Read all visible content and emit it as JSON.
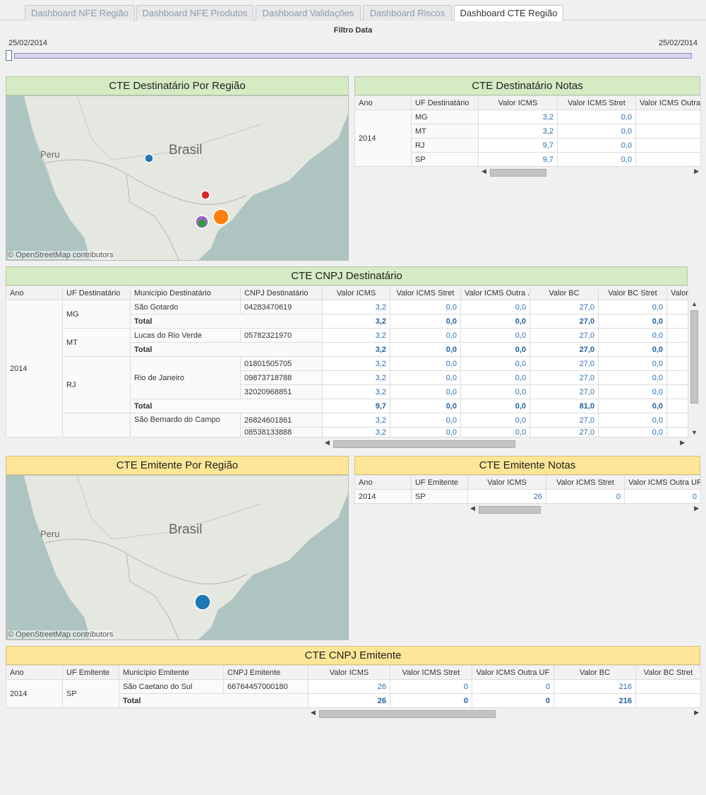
{
  "tabs": [
    "Dashboard NFE Região",
    "Dashboard NFE Produtos",
    "Dashboard Validações",
    "Dashboard Riscos",
    "Dashboard CTE Região"
  ],
  "filter": {
    "title": "Filtro Data",
    "start": "25/02/2014",
    "end": "25/02/2014"
  },
  "map_dest": {
    "title": "CTE Destinatário Por Região",
    "label_country": "Brasil",
    "label_neighbor": "Peru",
    "attribution": "© OpenStreetMap contributors",
    "points": [
      {
        "uf": "MT",
        "color": "#1f77b4"
      },
      {
        "uf": "MG",
        "color": "#d62728"
      },
      {
        "uf": "SP",
        "color": "#9467bd"
      },
      {
        "uf": "RJ",
        "color": "#ff7f0e"
      },
      {
        "uf": "SP2",
        "color": "#2ca02c"
      }
    ]
  },
  "notas_dest": {
    "title": "CTE Destinatário Notas",
    "headers": [
      "Ano",
      "UF Destinatário",
      "Valor ICMS",
      "Valor ICMS Stret",
      "Valor ICMS Outra UF"
    ],
    "year": "2014",
    "rows": [
      [
        "MG",
        "3,2",
        "0,0"
      ],
      [
        "MT",
        "3,2",
        "0,0"
      ],
      [
        "RJ",
        "9,7",
        "0,0"
      ],
      [
        "SP",
        "9,7",
        "0,0"
      ]
    ]
  },
  "cnpj_dest": {
    "title": "CTE CNPJ Destinatário",
    "headers": [
      "Ano",
      "UF Destinatário",
      "Município Destinatário",
      "CNPJ Destinatário",
      "Valor ICMS",
      "Valor ICMS Stret",
      "Valor ICMS Outra ..",
      "Valor BC",
      "Valor BC Stret",
      "Valor"
    ],
    "year": "2014",
    "total_label": "Total",
    "rows": [
      {
        "uf": "MG",
        "mun": "São Gotardo",
        "cnpj": "04283470619",
        "v": [
          "3,2",
          "0,0",
          "0,0",
          "27,0",
          "0,0"
        ]
      },
      {
        "uf": "",
        "mun": "",
        "cnpj": "",
        "v": [
          "3,2",
          "0,0",
          "0,0",
          "27,0",
          "0,0"
        ],
        "total": true
      },
      {
        "uf": "MT",
        "mun": "Lucas do Rio Verde",
        "cnpj": "05782321970",
        "v": [
          "3,2",
          "0,0",
          "0,0",
          "27,0",
          "0,0"
        ]
      },
      {
        "uf": "",
        "mun": "",
        "cnpj": "",
        "v": [
          "3,2",
          "0,0",
          "0,0",
          "27,0",
          "0,0"
        ],
        "total": true
      },
      {
        "uf": "RJ",
        "mun": "Rio de Janeiro",
        "cnpj": "01801505705",
        "v": [
          "3,2",
          "0,0",
          "0,0",
          "27,0",
          "0,0"
        ]
      },
      {
        "uf": "",
        "mun": "",
        "cnpj": "09873718788",
        "v": [
          "3,2",
          "0,0",
          "0,0",
          "27,0",
          "0,0"
        ]
      },
      {
        "uf": "",
        "mun": "",
        "cnpj": "32020968851",
        "v": [
          "3,2",
          "0,0",
          "0,0",
          "27,0",
          "0,0"
        ]
      },
      {
        "uf": "",
        "mun": "",
        "cnpj": "",
        "v": [
          "9,7",
          "0,0",
          "0,0",
          "81,0",
          "0,0"
        ],
        "total": true
      },
      {
        "uf": "",
        "mun": "São Bernardo do Campo",
        "cnpj": "26824601861",
        "v": [
          "3,2",
          "0,0",
          "0,0",
          "27,0",
          "0,0"
        ]
      },
      {
        "uf": "",
        "mun": "",
        "cnpj": "08538133888",
        "v": [
          "3,2",
          "0,0",
          "0,0",
          "27,0",
          "0,0"
        ]
      }
    ]
  },
  "map_emit": {
    "title": "CTE Emitente Por Região",
    "label_country": "Brasil",
    "label_neighbor": "Peru",
    "attribution": "© OpenStreetMap contributors",
    "points": [
      {
        "uf": "SP",
        "color": "#1f77b4"
      }
    ]
  },
  "notas_emit": {
    "title": "CTE Emitente Notas",
    "headers": [
      "Ano",
      "UF Emitente",
      "Valor ICMS",
      "Valor ICMS Stret",
      "Valor ICMS Outra UF"
    ],
    "row": [
      "2014",
      "SP",
      "26",
      "0",
      "0"
    ]
  },
  "cnpj_emit": {
    "title": "CTE CNPJ Emitente",
    "headers": [
      "Ano",
      "UF Emitente",
      "Município Emitente",
      "CNPJ Emitente",
      "Valor ICMS",
      "Valor ICMS Stret",
      "Valor ICMS Outra UF",
      "Valor BC",
      "Valor BC Stret"
    ],
    "year": "2014",
    "uf": "SP",
    "mun": "São Caetano do Sul",
    "cnpj": "66764457000180",
    "total_label": "Total",
    "v": [
      "26",
      "0",
      "0",
      "216"
    ],
    "tv": [
      "26",
      "0",
      "0",
      "216"
    ]
  }
}
